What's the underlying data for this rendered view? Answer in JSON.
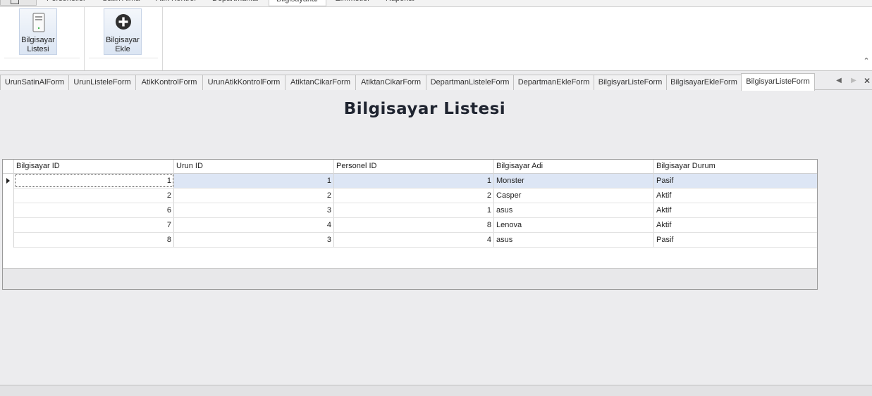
{
  "ribbon_tabs": [
    "Personeller",
    "Satın Alma",
    "Atık Kontrol",
    "Departmanlar",
    "Bilgisayarlar",
    "Zimmetler",
    "Raporlar"
  ],
  "ribbon_active_tab": "Bilgisayarlar",
  "ribbon": {
    "buttons": [
      {
        "label": "Bilgisayar\nListesi",
        "icon": "computer-tower-icon"
      },
      {
        "label": "Bilgisayar\nEkle",
        "icon": "add-circle-icon"
      }
    ]
  },
  "doc_tabs": [
    "UrunSatinAlForm",
    "UrunListeleForm",
    "AtikKontrolForm",
    "UrunAtikKontrolForm",
    "AtiktanCikarForm",
    "AtiktanCikarForm",
    "DepartmanListeleForm",
    "DepartmanEkleForm",
    "BilgisyarListeForm",
    "BilgisayarEkleForm",
    "BilgisyarListeForm"
  ],
  "active_doc_tab": "BilgisyarListeForm",
  "page_title": "Bilgisayar Listesi",
  "grid": {
    "columns": [
      "Bilgisayar ID",
      "Urun ID",
      "Personel ID",
      "Bilgisayar Adi",
      "Bilgisayar Durum"
    ],
    "rows": [
      [
        "1",
        "1",
        "1",
        "Monster",
        "Pasif"
      ],
      [
        "2",
        "2",
        "2",
        "Casper",
        "Aktif"
      ],
      [
        "6",
        "3",
        "1",
        "asus",
        "Aktif"
      ],
      [
        "7",
        "4",
        "8",
        "Lenova",
        "Aktif"
      ],
      [
        "8",
        "3",
        "4",
        "asus",
        "Pasif"
      ]
    ],
    "selected_row": 0
  },
  "colors": {
    "selection": "#dde6f5",
    "title": "#1f2430"
  }
}
